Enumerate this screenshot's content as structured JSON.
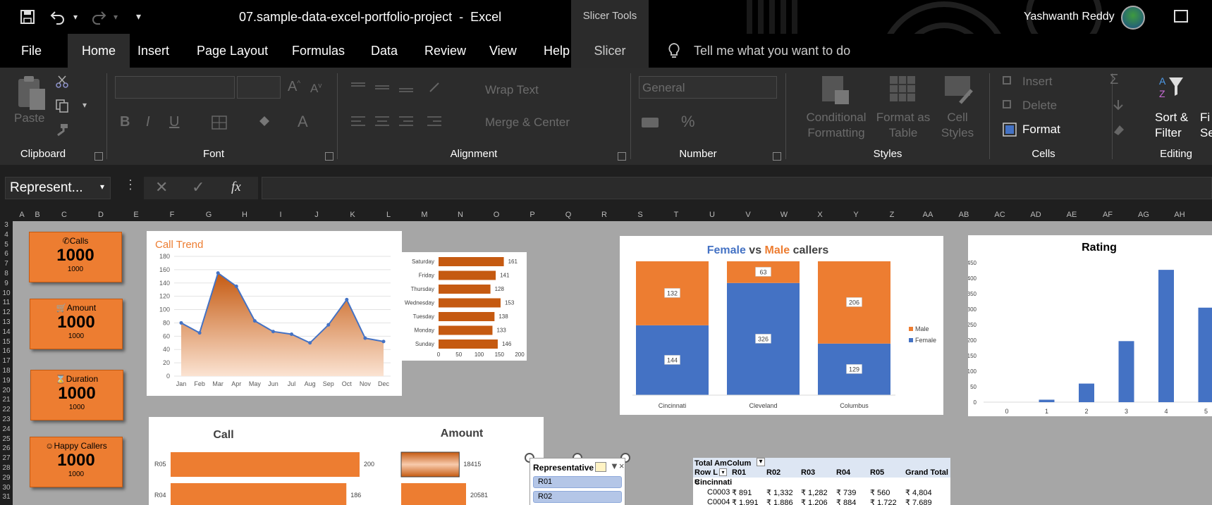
{
  "titlebar": {
    "document_title": "07.sample-data-excel-portfolio-project  -  Excel",
    "context_title": "Slicer Tools",
    "user_name": "Yashwanth Reddy"
  },
  "tabs": [
    "File",
    "Home",
    "Insert",
    "Page Layout",
    "Formulas",
    "Data",
    "Review",
    "View",
    "Help",
    "Slicer"
  ],
  "active_tab": "Home",
  "tell_me": "Tell me what you want to do",
  "ribbon": {
    "clipboard": {
      "paste": "Paste",
      "label": "Clipboard"
    },
    "font": {
      "label": "Font",
      "bold": "B",
      "italic": "I",
      "underline": "U"
    },
    "alignment": {
      "wrap": "Wrap Text",
      "merge": "Merge & Center",
      "label": "Alignment"
    },
    "number": {
      "format": "General",
      "label": "Number",
      "percent": "%"
    },
    "styles": {
      "conditional_1": "Conditional",
      "conditional_2": "Formatting",
      "table_1": "Format as",
      "table_2": "Table",
      "cell_1": "Cell",
      "cell_2": "Styles",
      "label": "Styles"
    },
    "cells": {
      "insert": "Insert",
      "delete": "Delete",
      "format": "Format",
      "label": "Cells"
    },
    "editing": {
      "sort_1": "Sort &",
      "sort_2": "Filter",
      "find_1": "Fi",
      "find_2": "Se",
      "label": "Editing"
    }
  },
  "formula_bar": {
    "name_box": "Represent...",
    "fx": "fx"
  },
  "columns": [
    "A",
    "B",
    "C",
    "D",
    "E",
    "F",
    "G",
    "H",
    "I",
    "J",
    "K",
    "L",
    "M",
    "N",
    "O",
    "P",
    "Q",
    "R",
    "S",
    "T",
    "U",
    "V",
    "W",
    "X",
    "Y",
    "Z",
    "AA",
    "AB",
    "AC",
    "AD",
    "AE",
    "AF",
    "AG",
    "AH"
  ],
  "rows": [
    "3",
    "4",
    "5",
    "6",
    "7",
    "8",
    "9",
    "10",
    "11",
    "12",
    "13",
    "14",
    "15",
    "16",
    "17",
    "18",
    "19",
    "20",
    "21",
    "22",
    "23",
    "24",
    "25",
    "26",
    "27",
    "28",
    "29",
    "30",
    "31"
  ],
  "kpis": [
    {
      "title": "Calls",
      "value": "1000",
      "sub": "1000",
      "icon": "phone-icon"
    },
    {
      "title": "Amount",
      "value": "1000",
      "sub": "1000",
      "icon": "cart-icon"
    },
    {
      "title": "Duration",
      "value": "1000",
      "sub": "1000",
      "icon": "hourglass-icon"
    },
    {
      "title": "Happy Callers",
      "value": "1000",
      "sub": "1000",
      "icon": "smiley-icon"
    }
  ],
  "colors": {
    "orange": "#ed7d31",
    "dark_orange": "#c55a11",
    "blue": "#4472c4"
  },
  "chart_data": [
    {
      "type": "area",
      "title": "Call Trend",
      "categories": [
        "Jan",
        "Feb",
        "Mar",
        "Apr",
        "May",
        "Jun",
        "Jul",
        "Aug",
        "Sep",
        "Oct",
        "Nov",
        "Dec"
      ],
      "values": [
        80,
        65,
        155,
        135,
        83,
        67,
        63,
        50,
        77,
        115,
        57,
        52
      ],
      "ylim": [
        0,
        180
      ],
      "yticks": [
        "0",
        "20",
        "40",
        "60",
        "80",
        "100",
        "120",
        "140",
        "160",
        "180"
      ]
    },
    {
      "type": "bar",
      "orientation": "horizontal",
      "categories": [
        "Saturday",
        "Friday",
        "Thursday",
        "Wednesday",
        "Tuesday",
        "Monday",
        "Sunday"
      ],
      "values": [
        161,
        141,
        128,
        153,
        138,
        133,
        146
      ],
      "xlim": [
        0,
        200
      ],
      "xticks": [
        "0",
        "50",
        "100",
        "150",
        "200"
      ]
    },
    {
      "type": "bar",
      "stacked": true,
      "title_parts": [
        "Female",
        " vs ",
        "Male",
        " callers"
      ],
      "categories": [
        "Cincinnati",
        "Cleveland",
        "Columbus"
      ],
      "series": [
        {
          "name": "Female",
          "values": [
            144,
            326,
            129
          ]
        },
        {
          "name": "Male",
          "values": [
            132,
            63,
            206
          ]
        }
      ],
      "legend": "right"
    },
    {
      "type": "bar",
      "title": "Rating",
      "categories": [
        "0",
        "1",
        "2",
        "3",
        "4",
        "5"
      ],
      "values": [
        0,
        8,
        60,
        197,
        427,
        305
      ],
      "ylim": [
        0,
        450
      ],
      "yticks": [
        "0",
        "50",
        "100",
        "150",
        "200",
        "250",
        "300",
        "350",
        "400",
        "450"
      ]
    },
    {
      "type": "bar",
      "orientation": "horizontal",
      "title": "Call",
      "categories": [
        "R05",
        "R04"
      ],
      "values": [
        200,
        186
      ]
    },
    {
      "type": "bar",
      "orientation": "horizontal",
      "title": "Amount",
      "values": [
        18415,
        20581
      ]
    }
  ],
  "slicer": {
    "title": "Representative",
    "items": [
      "R01",
      "R02"
    ]
  },
  "pivot": {
    "header1": [
      "Total Am",
      "Colum"
    ],
    "header2": [
      "Row L",
      "R01",
      "R02",
      "R03",
      "R04",
      "R05",
      "Grand Total"
    ],
    "group": "Cincinnati",
    "rows": [
      [
        "C0003",
        "₹ 891",
        "₹ 1,332",
        "₹ 1,282",
        "₹ 739",
        "₹ 560",
        "₹ 4,804"
      ],
      [
        "C0004",
        "₹ 1,991",
        "₹ 1,886",
        "₹ 1,206",
        "₹ 884",
        "₹ 1,722",
        "₹ 7,689"
      ]
    ]
  }
}
